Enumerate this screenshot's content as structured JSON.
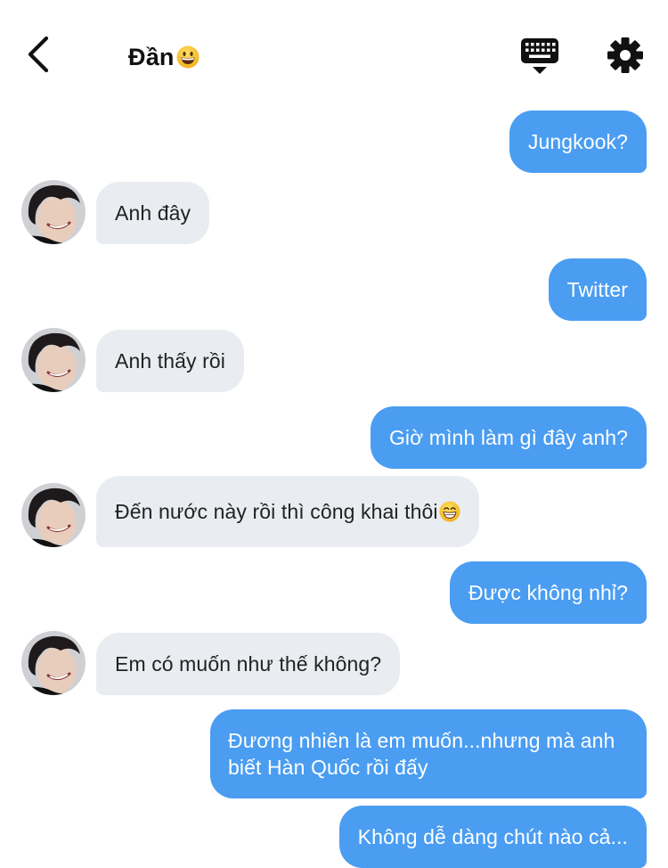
{
  "header": {
    "contact_name": "Đần",
    "contact_emoji": "grinning-face-emoji"
  },
  "icons": {
    "back": "chevron-left-icon",
    "keyboard": "keyboard-hide-icon",
    "settings": "gear-icon"
  },
  "colors": {
    "outgoing_bubble": "#4a9df1",
    "incoming_bubble": "#e9ecf0"
  },
  "messages": [
    {
      "direction": "out",
      "text": "Jungkook?"
    },
    {
      "direction": "in",
      "text": "Anh đây"
    },
    {
      "direction": "out",
      "text": "Twitter"
    },
    {
      "direction": "in",
      "text": "Anh thấy rồi"
    },
    {
      "direction": "out",
      "text": "Giờ mình làm gì đây anh?"
    },
    {
      "direction": "in",
      "text": "Đến nước này rồi thì công khai thôi",
      "emoji": "beaming-face-emoji"
    },
    {
      "direction": "out",
      "text": "Được không nhỉ?"
    },
    {
      "direction": "in",
      "text": "Em có muốn như thế không?"
    },
    {
      "direction": "out",
      "text": "Đương nhiên là em muốn...nhưng mà anh biết Hàn Quốc rồi đấy"
    },
    {
      "direction": "out",
      "text": "Không dễ dàng chút nào cả..."
    }
  ]
}
